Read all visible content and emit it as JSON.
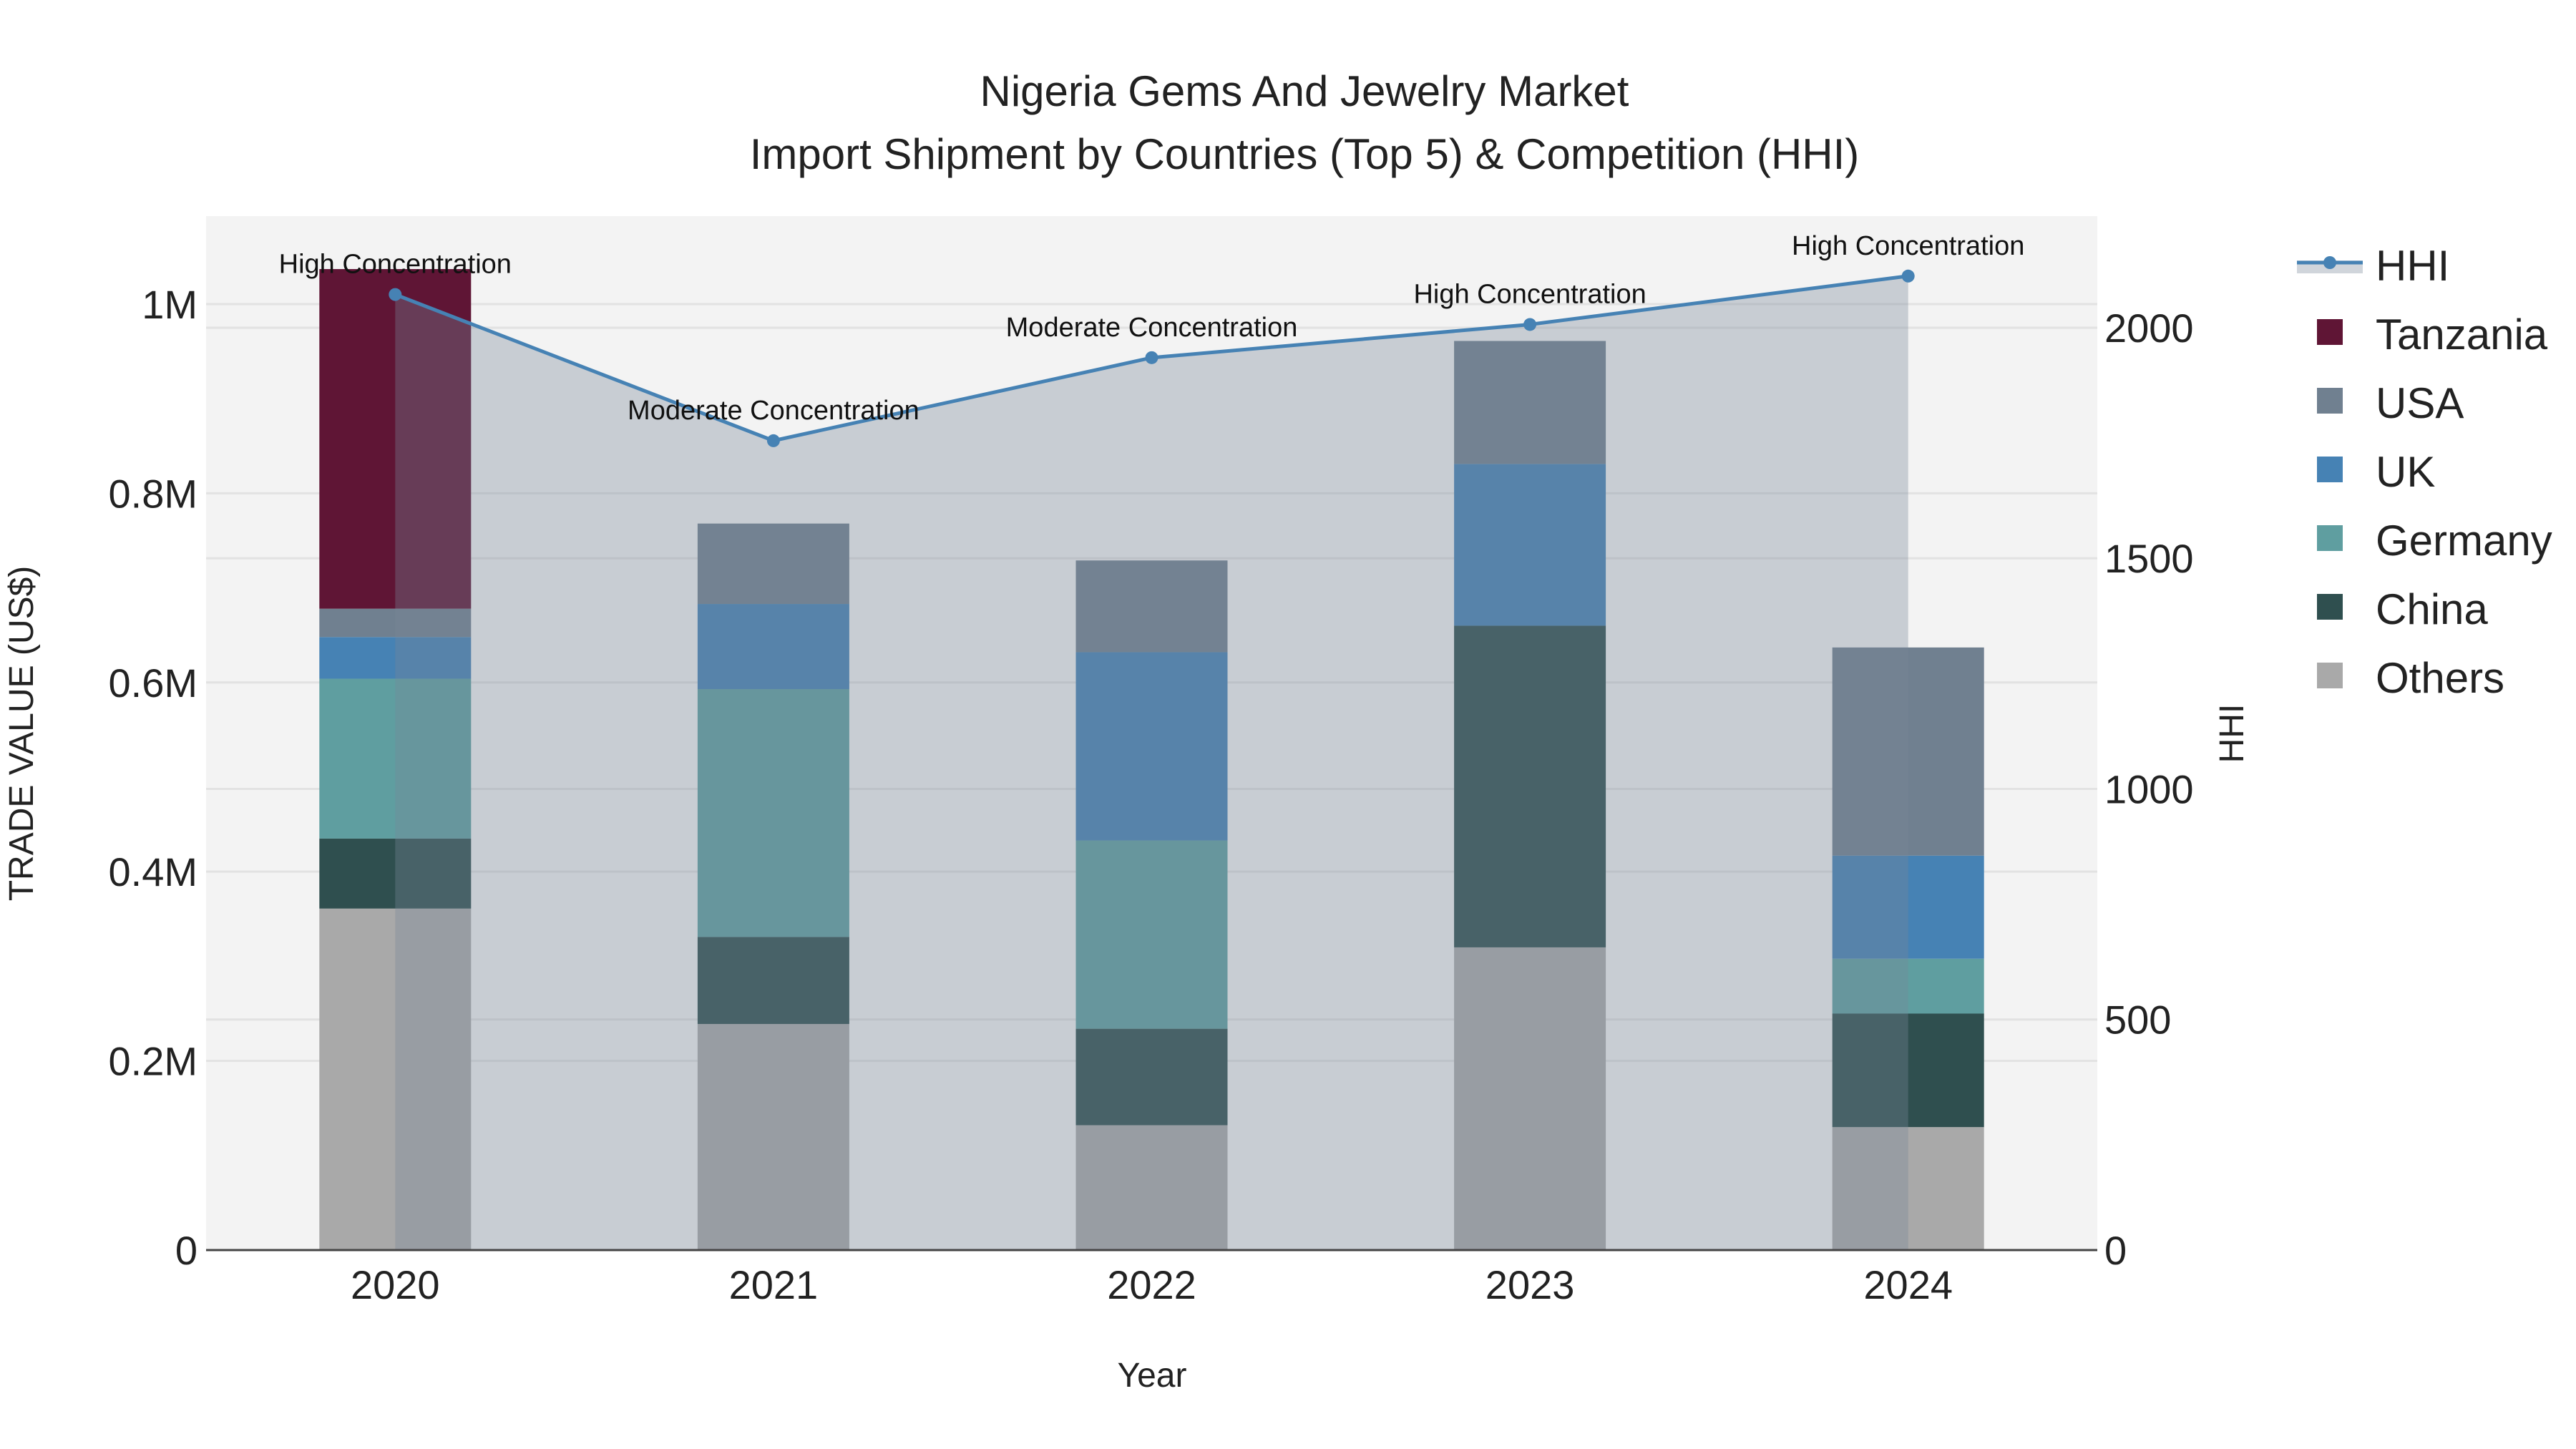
{
  "chart_data": {
    "type": "bar",
    "stacked": true,
    "title": "Nigeria Gems And Jewelry Market",
    "subtitle": "Import Shipment by Countries (Top 5) & Competition (HHI)",
    "xlabel": "Year",
    "ylabel": "TRADE VALUE (US$)",
    "y2label": "HHI",
    "categories": [
      "2020",
      "2021",
      "2022",
      "2023",
      "2024"
    ],
    "ylim": [
      0,
      1093000
    ],
    "y2lim": [
      0,
      2242
    ],
    "yticks": [
      0,
      200000,
      400000,
      600000,
      800000,
      1000000
    ],
    "ytick_labels": [
      "0",
      "0.2M",
      "0.4M",
      "0.6M",
      "0.8M",
      "1M"
    ],
    "y2ticks": [
      0,
      500,
      1000,
      1500,
      2000
    ],
    "y2tick_labels": [
      "0",
      "500",
      "1000",
      "1500",
      "2000"
    ],
    "grid": true,
    "legend_position": "right",
    "series": [
      {
        "name": "Others",
        "color": "#a9a9a9",
        "values": [
          361000,
          239000,
          132000,
          320000,
          130000
        ]
      },
      {
        "name": "China",
        "color": "#2f4f4f",
        "values": [
          74000,
          92000,
          102000,
          340000,
          120000
        ]
      },
      {
        "name": "Germany",
        "color": "#5f9ea0",
        "values": [
          169000,
          262000,
          199000,
          0,
          58000
        ]
      },
      {
        "name": "UK",
        "color": "#4682b4",
        "values": [
          44000,
          90000,
          199000,
          171000,
          109000
        ]
      },
      {
        "name": "USA",
        "color": "#708090",
        "values": [
          30000,
          85000,
          97000,
          130000,
          220000
        ]
      },
      {
        "name": "Tanzania",
        "color": "#5f1535",
        "values": [
          359000,
          0,
          0,
          0,
          0
        ]
      }
    ],
    "line_series": {
      "name": "HHI",
      "color": "#4682b4",
      "axis": "right",
      "values": [
        2072,
        1755,
        1935,
        2007,
        2112
      ],
      "annotations": [
        "High Concentration",
        "Moderate Concentration",
        "Moderate Concentration",
        "High Concentration",
        "High Concentration"
      ]
    },
    "legend": [
      "HHI",
      "Tanzania",
      "USA",
      "UK",
      "Germany",
      "China",
      "Others"
    ]
  }
}
